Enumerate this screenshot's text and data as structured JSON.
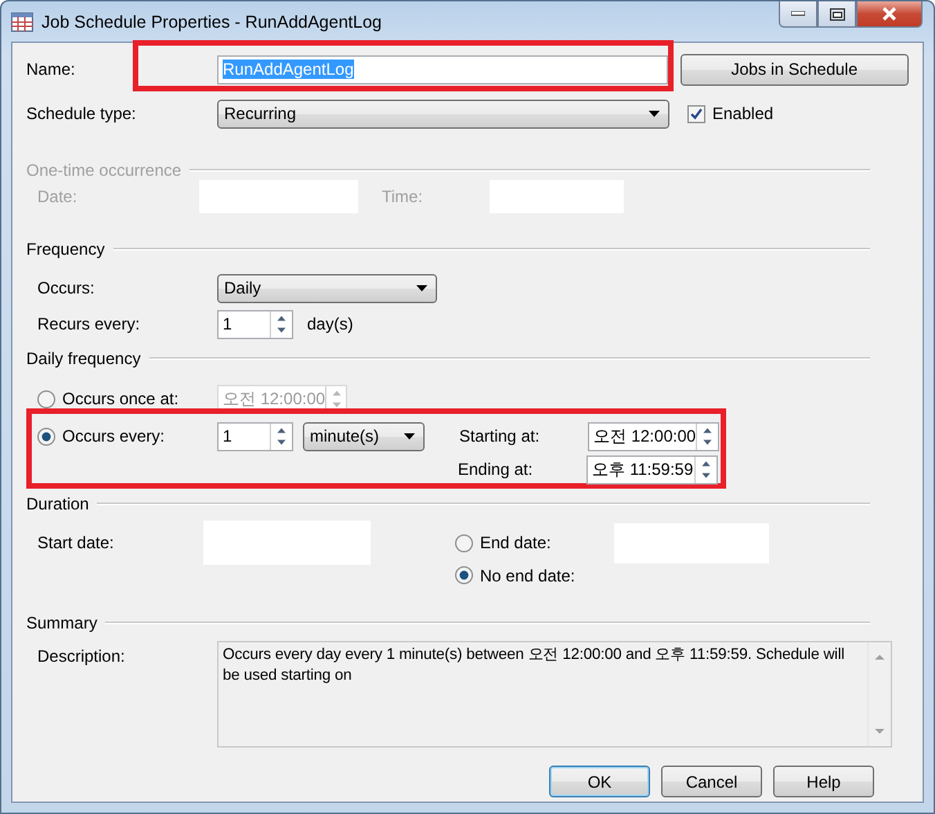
{
  "window": {
    "title": "Job Schedule Properties - RunAddAgentLog"
  },
  "name": {
    "label": "Name:",
    "value": "RunAddAgentLog",
    "text_selected": true,
    "highlighted": true
  },
  "jobs_button": "Jobs in Schedule",
  "schedule_type": {
    "label": "Schedule type:",
    "value": "Recurring"
  },
  "enabled": {
    "label": "Enabled",
    "checked": true
  },
  "one_time_occurrence": {
    "title": "One-time occurrence",
    "disabled": true,
    "date_label": "Date:",
    "time_label": "Time:"
  },
  "frequency": {
    "title": "Frequency",
    "occurs_label": "Occurs:",
    "occurs_value": "Daily",
    "recurs_label": "Recurs every:",
    "recurs_value": "1",
    "recurs_unit": "day(s)"
  },
  "daily_frequency": {
    "title": "Daily frequency",
    "highlighted": true,
    "options": [
      {
        "label": "Occurs once at:",
        "selected": false
      },
      {
        "label": "Occurs every:",
        "selected": true
      }
    ],
    "once_time": "오전 12:00:00",
    "every_value": "1",
    "every_unit": "minute(s)",
    "starting_label": "Starting at:",
    "starting_value": "오전 12:00:00",
    "ending_label": "Ending at:",
    "ending_value": "오후 11:59:59"
  },
  "duration": {
    "title": "Duration",
    "start_label": "Start date:",
    "options": [
      {
        "label": "End date:",
        "selected": false
      },
      {
        "label": "No end date:",
        "selected": true
      }
    ]
  },
  "summary": {
    "title": "Summary",
    "description_label": "Description:",
    "description": "Occurs every day every 1 minute(s) between 오전 12:00:00 and 오후 11:59:59. Schedule will be used starting on"
  },
  "buttons": [
    {
      "label": "OK",
      "default": true
    },
    {
      "label": "Cancel",
      "default": false
    },
    {
      "label": "Help",
      "default": false
    }
  ]
}
